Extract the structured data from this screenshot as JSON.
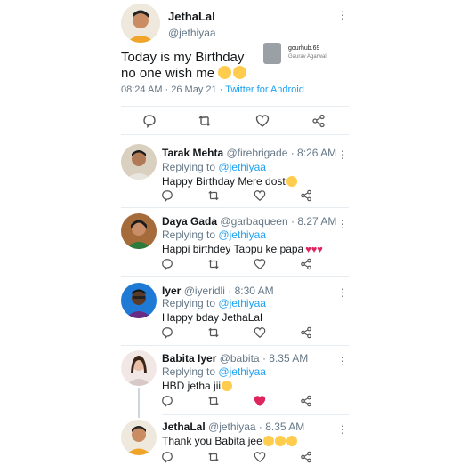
{
  "tweet": {
    "author_name": "JethaLal",
    "handle": "@jethiyaa",
    "text_line1": "Today is my Birthday",
    "text_line2": "no one wish me",
    "time": "08:24 AM · 26 May 21 · ",
    "source": "Twitter for Android"
  },
  "watermark": {
    "user": "gourhub.69",
    "name": "Gaurav Agarwal"
  },
  "replies": [
    {
      "name": "Tarak Mehta",
      "handle": "@firebrigade",
      "time": "· 8:26 AM",
      "replying_label": "Replying to",
      "replying_to": "@jethiyaa",
      "text": "Happy Birthday Mere dost"
    },
    {
      "name": "Daya Gada",
      "handle": "@garbaqueen",
      "time": "· 8.27 AM",
      "replying_label": "Replying to",
      "replying_to": "@jethiyaa",
      "text": "Happi birthdey Tappu ke papa"
    },
    {
      "name": "Iyer",
      "handle": "@iyeridli",
      "time": "· 8:30 AM",
      "replying_label": "Replying to",
      "replying_to": "@jethiyaa",
      "text": "Happy bday JethaLal"
    },
    {
      "name": "Babita Iyer",
      "handle": "@babita",
      "time": "· 8.35 AM",
      "replying_label": "Replying to",
      "replying_to": "@jethiyaa",
      "text": "HBD jetha jii"
    },
    {
      "name": "JethaLal",
      "handle": "@jethiyaa",
      "time": "· 8.35 AM",
      "replying_label": "",
      "replying_to": "",
      "text": "Thank you Babita jee"
    }
  ],
  "colors": {
    "link": "#1da1f2",
    "liked": "#e0245e",
    "muted": "#657786"
  },
  "icons": [
    "reply-icon",
    "retweet-icon",
    "like-icon",
    "share-icon",
    "more-icon"
  ]
}
